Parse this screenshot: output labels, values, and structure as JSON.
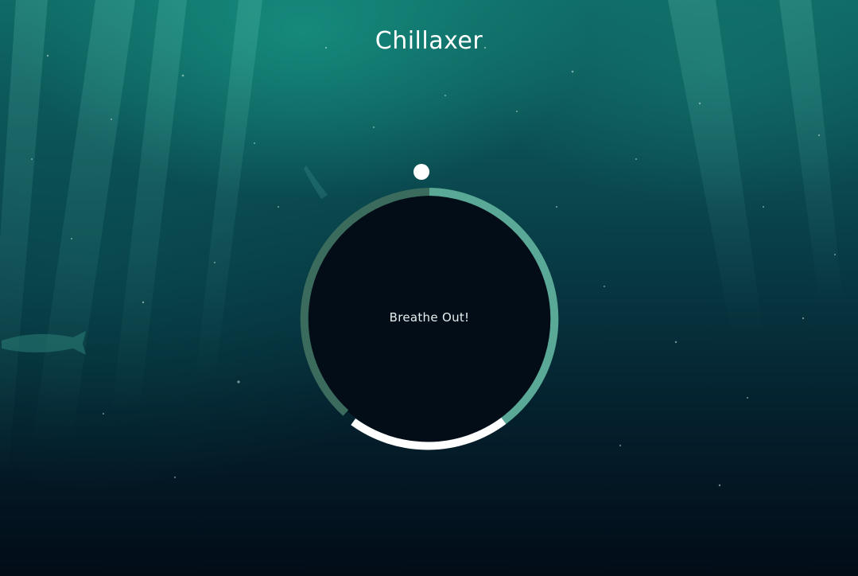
{
  "app": {
    "title": "Chillaxer"
  },
  "breathing": {
    "instruction": "Breathe Out!",
    "colors": {
      "inner": "#020d18",
      "breathe_in_segment": "#5aa997",
      "hold_segment": "#ffffff",
      "breathe_out_segment": "#3b6b5d",
      "pointer": "#ffffff"
    }
  }
}
